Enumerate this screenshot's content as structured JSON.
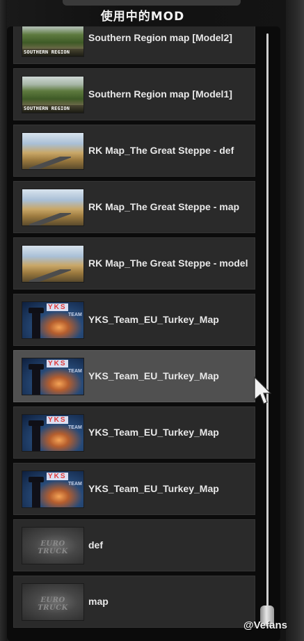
{
  "header": {
    "title": "使用中的MOD"
  },
  "mods": [
    {
      "label": "Southern Region map [Model2]",
      "thumb_type": "southern",
      "thumb_caption": "SOUTHERN REGION"
    },
    {
      "label": "Southern Region map [Model1]",
      "thumb_type": "southern",
      "thumb_caption": "SOUTHERN REGION"
    },
    {
      "label": "RK Map_The Great Steppe - def",
      "thumb_type": "steppe"
    },
    {
      "label": "RK Map_The Great Steppe - map",
      "thumb_type": "steppe"
    },
    {
      "label": "RK Map_The Great Steppe - model",
      "thumb_type": "steppe"
    },
    {
      "label": "YKS_Team_EU_Turkey_Map",
      "thumb_type": "yks",
      "thumb_logo": "YKS",
      "thumb_sub": "TEAM"
    },
    {
      "label": "YKS_Team_EU_Turkey_Map",
      "thumb_type": "yks",
      "thumb_logo": "YKS",
      "thumb_sub": "TEAM",
      "hovered": true
    },
    {
      "label": "YKS_Team_EU_Turkey_Map",
      "thumb_type": "yks",
      "thumb_logo": "YKS",
      "thumb_sub": "TEAM"
    },
    {
      "label": "YKS_Team_EU_Turkey_Map",
      "thumb_type": "yks",
      "thumb_logo": "YKS",
      "thumb_sub": "TEAM"
    },
    {
      "label": "def",
      "thumb_type": "ets",
      "thumb_caption": "EURO TRUCK"
    },
    {
      "label": "map",
      "thumb_type": "ets",
      "thumb_caption": "EURO TRUCK"
    }
  ],
  "watermark": "@Vefans",
  "icons": {
    "cursor": "mouse-pointer-icon"
  }
}
